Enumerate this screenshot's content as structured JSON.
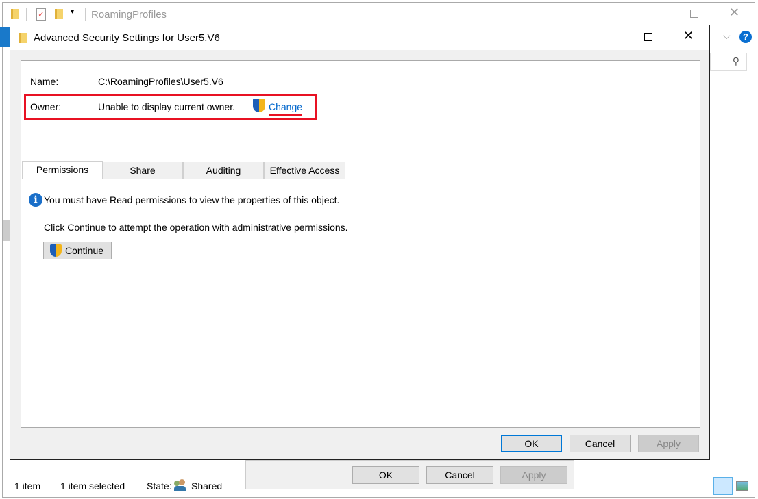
{
  "explorer": {
    "title": "RoamingProfiles",
    "status": {
      "item_count": "1 item",
      "selected": "1 item selected",
      "state_label": "State:",
      "state_value": "Shared"
    },
    "behind_dialog_buttons": {
      "ok": "OK",
      "cancel": "Cancel",
      "apply": "Apply"
    }
  },
  "dialog": {
    "title": "Advanced Security Settings for User5.V6",
    "name_label": "Name:",
    "name_value": "C:\\RoamingProfiles\\User5.V6",
    "owner_label": "Owner:",
    "owner_value": "Unable to display current owner.",
    "change_link": "Change",
    "tabs": [
      {
        "label": "Permissions",
        "active": true
      },
      {
        "label": "Share"
      },
      {
        "label": "Auditing"
      },
      {
        "label": "Effective Access"
      }
    ],
    "info_message": "You must have Read permissions to view the properties of this object.",
    "continue_message": "Click Continue to attempt the operation with administrative permissions.",
    "continue_button": "Continue",
    "buttons": {
      "ok": "OK",
      "cancel": "Cancel",
      "apply": "Apply"
    }
  },
  "colors": {
    "accent": "#0078d7",
    "highlight": "#e81123",
    "link": "#0066cc"
  }
}
